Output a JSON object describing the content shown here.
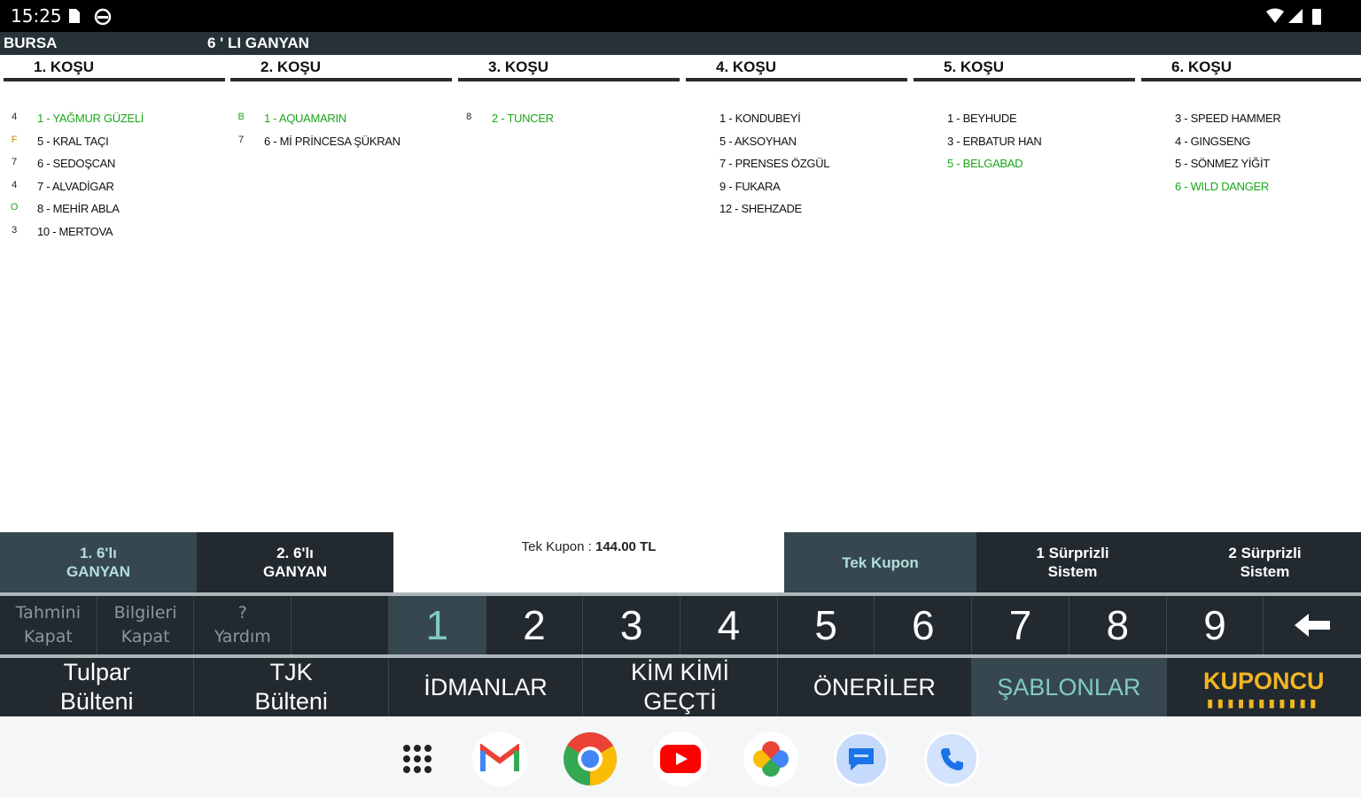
{
  "status_bar": {
    "time": "15:25"
  },
  "header": {
    "city": "BURSA",
    "bet_type": "6 ' LI GANYAN"
  },
  "races": [
    {
      "title": "1. KOŞU",
      "entries": [
        {
          "mark": "4",
          "label": "1 - YAĞMUR GÜZELİ",
          "highlight": true
        },
        {
          "mark": "F",
          "label": "5 - KRAL TAÇI",
          "highlight": false
        },
        {
          "mark": "7",
          "label": "6 - SEDOŞCAN",
          "highlight": false
        },
        {
          "mark": "4",
          "label": "7 - ALVADİGAR",
          "highlight": false
        },
        {
          "mark": "O",
          "label": "8 - MEHİR ABLA",
          "highlight": false
        },
        {
          "mark": "3",
          "label": "10 - MERTOVA",
          "highlight": false
        }
      ]
    },
    {
      "title": "2. KOŞU",
      "entries": [
        {
          "mark": "B",
          "label": "1 - AQUAMARIN",
          "highlight": true
        },
        {
          "mark": "7",
          "label": "6 - Mİ PRİNCESA ŞÜKRAN",
          "highlight": false
        }
      ]
    },
    {
      "title": "3. KOŞU",
      "entries": [
        {
          "mark": "8",
          "label": "2 - TUNCER",
          "highlight": true
        }
      ]
    },
    {
      "title": "4. KOŞU",
      "entries": [
        {
          "mark": "",
          "label": "1 - KONDUBEYİ",
          "highlight": false
        },
        {
          "mark": "",
          "label": "5 - AKSOYHAN",
          "highlight": false
        },
        {
          "mark": "",
          "label": "7 - PRENSES ÖZGÜL",
          "highlight": false
        },
        {
          "mark": "",
          "label": "9 - FUKARA",
          "highlight": false
        },
        {
          "mark": "",
          "label": "12 - SHEHZADE",
          "highlight": false
        }
      ]
    },
    {
      "title": "5. KOŞU",
      "entries": [
        {
          "mark": "",
          "label": "1 - BEYHUDE",
          "highlight": false
        },
        {
          "mark": "",
          "label": "3 - ERBATUR HAN",
          "highlight": false
        },
        {
          "mark": "",
          "label": "5 - BELGABAD",
          "highlight": true
        }
      ]
    },
    {
      "title": "6. KOŞU",
      "entries": [
        {
          "mark": "",
          "label": "3 - SPEED HAMMER",
          "highlight": false
        },
        {
          "mark": "",
          "label": "4 - GINGSENG",
          "highlight": false
        },
        {
          "mark": "",
          "label": "5 - SÖNMEZ YİĞİT",
          "highlight": false
        },
        {
          "mark": "",
          "label": "6 - WILD DANGER",
          "highlight": true
        }
      ]
    }
  ],
  "tabs_left": [
    {
      "label": "1. 6'lı\nGANYAN",
      "active": true
    },
    {
      "label": "2. 6'lı\nGANYAN",
      "active": false
    }
  ],
  "coupon": {
    "label": "Tek Kupon : ",
    "amount": "144.00 TL"
  },
  "tabs_right": [
    {
      "label": "Tek Kupon",
      "active": true
    },
    {
      "label": "1 Sürprizli\nSistem",
      "active": false
    },
    {
      "label": "2 Sürprizli\nSistem",
      "active": false
    }
  ],
  "key_small": [
    {
      "label": "Tahmini\nKapat"
    },
    {
      "label": "Bilgileri\nKapat"
    },
    {
      "label": "?\nYardım"
    },
    {
      "label": ""
    }
  ],
  "key_numbers": [
    "1",
    "2",
    "3",
    "4",
    "5",
    "6",
    "7",
    "8",
    "9"
  ],
  "active_number": "1",
  "nav": [
    {
      "label": "Tulpar\nBülteni"
    },
    {
      "label": "TJK\nBülteni"
    },
    {
      "label": "İDMANLAR"
    },
    {
      "label": "KİM KİMİ\nGEÇTİ"
    },
    {
      "label": "ÖNERİLER"
    },
    {
      "label": "ŞABLONLAR"
    },
    {
      "label": "KUPONCU"
    }
  ],
  "kuponcu_dots": "▮▮▮▮▮▮▮▮▮▮▮",
  "dock_apps": [
    "apps-grid",
    "gmail",
    "chrome",
    "youtube",
    "photos",
    "messages",
    "phone"
  ],
  "colors": {
    "highlight_green": "#1aa81a",
    "accent_teal": "#80cbc4",
    "kuponcu_gold": "#f2b624",
    "panel_dark": "#222a2f"
  }
}
